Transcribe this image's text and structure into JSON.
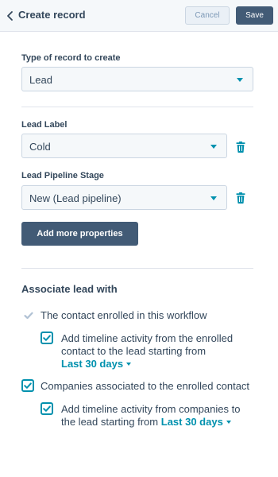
{
  "header": {
    "title": "Create record",
    "cancel_label": "Cancel",
    "save_label": "Save"
  },
  "record_type": {
    "label": "Type of record to create",
    "value": "Lead"
  },
  "lead_label": {
    "label": "Lead Label",
    "value": "Cold"
  },
  "lead_pipeline_stage": {
    "label": "Lead Pipeline Stage",
    "value": "New (Lead pipeline)"
  },
  "add_properties_label": "Add more properties",
  "associate": {
    "title": "Associate lead with",
    "contact": {
      "label": "The contact enrolled in this workflow",
      "checked": true,
      "disabled": true,
      "timeline": {
        "text": "Add timeline activity from the enrolled contact to the lead starting from",
        "range": "Last 30 days",
        "checked": true
      }
    },
    "companies": {
      "label": "Companies associated to the enrolled contact",
      "checked": true,
      "timeline": {
        "text": "Add timeline activity from companies to the lead starting from",
        "range": "Last 30 days",
        "checked": true
      }
    }
  },
  "colors": {
    "accent": "#0091ae",
    "primary_button": "#425b76",
    "text": "#33475b"
  }
}
